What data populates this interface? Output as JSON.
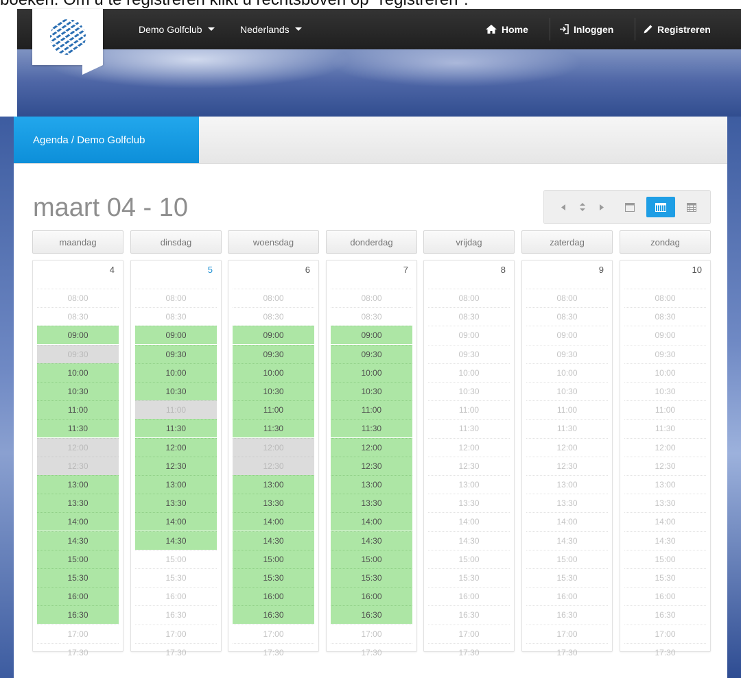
{
  "caption": "boeken. Om u te registreren klikt u rechtsboven op \"registreren\".",
  "nav": {
    "club": "Demo Golfclub",
    "language": "Nederlands",
    "home": "Home",
    "login": "Inloggen",
    "register": "Registreren"
  },
  "tab": {
    "label": "Agenda / Demo Golfclub"
  },
  "calendar": {
    "range_title": "maart 04 - 10",
    "view_controls": {
      "prev": "◀",
      "today": "⇕",
      "next": "▶",
      "active_view": "week"
    },
    "slot_colors": {
      "free": "#ade6a5",
      "busy": "#dcdcdc",
      "none": "#ffffff"
    },
    "times": [
      "08:00",
      "08:30",
      "09:00",
      "09:30",
      "10:00",
      "10:30",
      "11:00",
      "11:30",
      "12:00",
      "12:30",
      "13:00",
      "13:30",
      "14:00",
      "14:30",
      "15:00",
      "15:30",
      "16:00",
      "16:30",
      "17:00",
      "17:30"
    ],
    "days": [
      {
        "name": "maandag",
        "date": "4",
        "today": false,
        "status": [
          "none",
          "none",
          "free",
          "busy",
          "free",
          "free",
          "free",
          "free",
          "busy",
          "busy",
          "free",
          "free",
          "free",
          "free",
          "free",
          "free",
          "free",
          "free",
          "none",
          "none"
        ]
      },
      {
        "name": "dinsdag",
        "date": "5",
        "today": true,
        "status": [
          "none",
          "none",
          "free",
          "free",
          "free",
          "free",
          "busy",
          "free",
          "free",
          "free",
          "free",
          "free",
          "free",
          "free",
          "none",
          "none",
          "none",
          "none",
          "none",
          "none"
        ]
      },
      {
        "name": "woensdag",
        "date": "6",
        "today": false,
        "status": [
          "none",
          "none",
          "free",
          "free",
          "free",
          "free",
          "free",
          "free",
          "busy",
          "busy",
          "free",
          "free",
          "free",
          "free",
          "free",
          "free",
          "free",
          "free",
          "none",
          "none"
        ]
      },
      {
        "name": "donderdag",
        "date": "7",
        "today": false,
        "status": [
          "none",
          "none",
          "free",
          "free",
          "free",
          "free",
          "free",
          "free",
          "free",
          "free",
          "free",
          "free",
          "free",
          "free",
          "free",
          "free",
          "free",
          "free",
          "none",
          "none"
        ]
      },
      {
        "name": "vrijdag",
        "date": "8",
        "today": false,
        "status": [
          "none",
          "none",
          "none",
          "none",
          "none",
          "none",
          "none",
          "none",
          "none",
          "none",
          "none",
          "none",
          "none",
          "none",
          "none",
          "none",
          "none",
          "none",
          "none",
          "none"
        ]
      },
      {
        "name": "zaterdag",
        "date": "9",
        "today": false,
        "status": [
          "none",
          "none",
          "none",
          "none",
          "none",
          "none",
          "none",
          "none",
          "none",
          "none",
          "none",
          "none",
          "none",
          "none",
          "none",
          "none",
          "none",
          "none",
          "none",
          "none"
        ]
      },
      {
        "name": "zondag",
        "date": "10",
        "today": false,
        "status": [
          "none",
          "none",
          "none",
          "none",
          "none",
          "none",
          "none",
          "none",
          "none",
          "none",
          "none",
          "none",
          "none",
          "none",
          "none",
          "none",
          "none",
          "none",
          "none",
          "none"
        ]
      }
    ]
  }
}
